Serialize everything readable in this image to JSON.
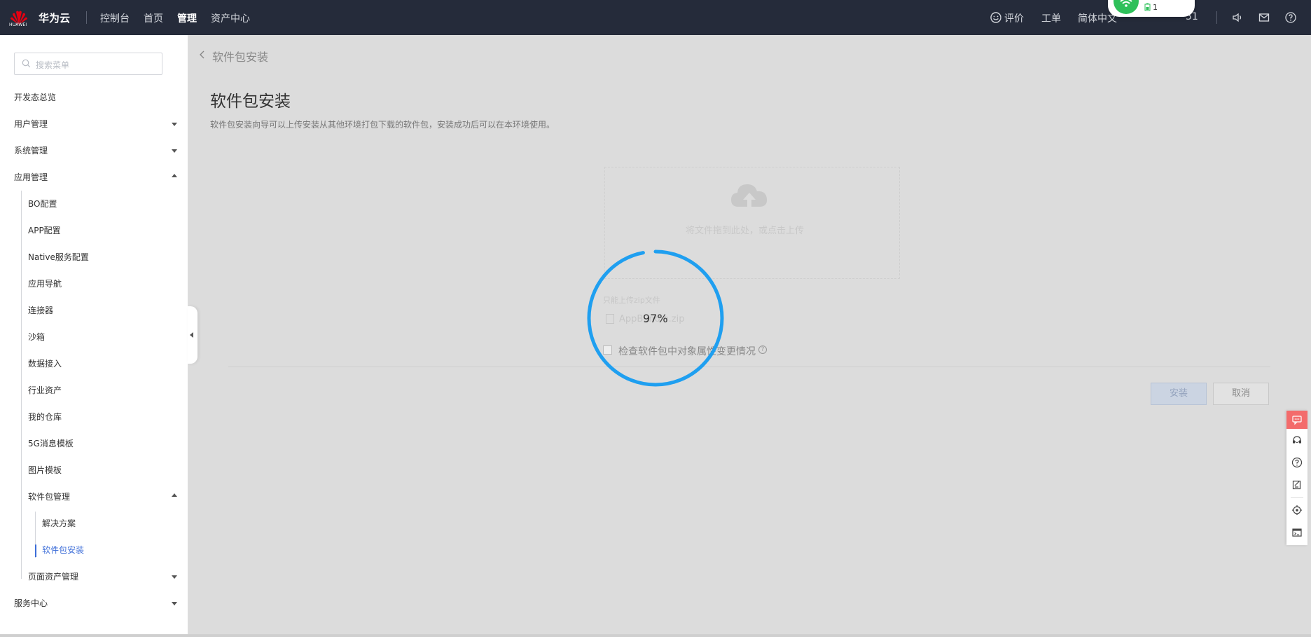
{
  "topbar": {
    "brand_logo_text": "HUAWEI",
    "brand": "华为云",
    "nav": [
      "控制台",
      "首页",
      "管理",
      "资产中心"
    ],
    "active_nav": "管理",
    "right": {
      "rate": "评价",
      "ticket": "工单",
      "lang": "简体中文",
      "user_fragment": "51"
    },
    "wifi_popup_count": "1"
  },
  "sidebar": {
    "search_placeholder": "搜索菜单",
    "items": [
      {
        "label": "开发态总览"
      },
      {
        "label": "用户管理"
      },
      {
        "label": "系统管理"
      },
      {
        "label": "应用管理"
      },
      {
        "label": "BO配置"
      },
      {
        "label": "APP配置"
      },
      {
        "label": "Native服务配置"
      },
      {
        "label": "应用导航"
      },
      {
        "label": "连接器"
      },
      {
        "label": "沙箱"
      },
      {
        "label": "数据接入"
      },
      {
        "label": "行业资产"
      },
      {
        "label": "我的仓库"
      },
      {
        "label": "5G消息模板"
      },
      {
        "label": "图片模板"
      },
      {
        "label": "软件包管理"
      },
      {
        "label": "解决方案"
      },
      {
        "label": "软件包安装"
      },
      {
        "label": "页面资产管理"
      },
      {
        "label": "服务中心"
      }
    ],
    "active_item": "软件包安装"
  },
  "main": {
    "breadcrumb": "软件包安装",
    "title": "软件包安装",
    "description": "软件包安装向导可以上传安装从其他环境打包下载的软件包，安装成功后可以在本环境使用。",
    "upload_text": "将文件拖到此处，或点击上传",
    "hint": "只能上传zip文件",
    "file_name": "AppBundle.zip",
    "checkbox_label": "检查软件包中对象属性变更情况",
    "install_button": "安装",
    "cancel_button": "取消"
  },
  "loading": {
    "progress_text": "97%",
    "progress": 0.97,
    "color": "#1f9ff0"
  },
  "colors": {
    "topbar_bg": "#252b3a",
    "accent": "#3c6dd8",
    "overlay_bg": "#dcdcdc"
  }
}
